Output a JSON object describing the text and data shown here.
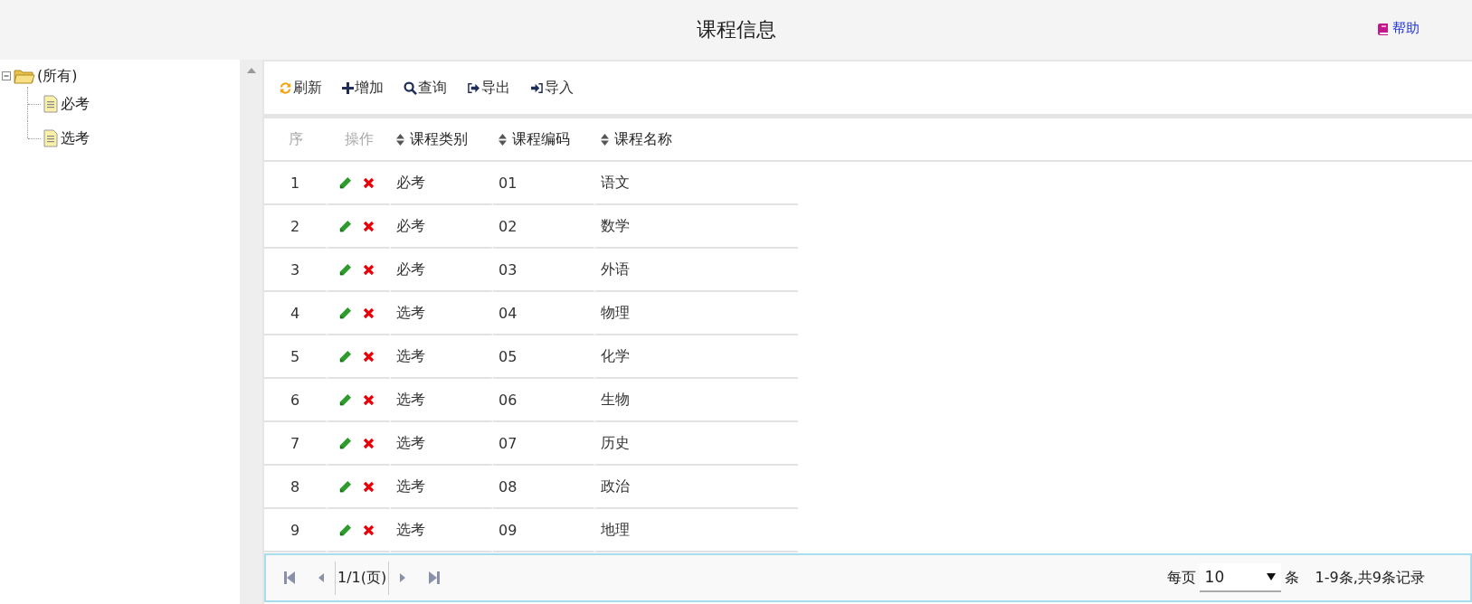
{
  "header": {
    "title": "课程信息",
    "help": "帮助"
  },
  "tree": {
    "label": "(所有)",
    "expanded": true,
    "children": [
      {
        "label": "必考"
      },
      {
        "label": "选考"
      }
    ]
  },
  "toolbar": [
    {
      "kind": "refresh",
      "label": "刷新"
    },
    {
      "kind": "add",
      "label": "增加"
    },
    {
      "kind": "search",
      "label": "查询"
    },
    {
      "kind": "export",
      "label": "导出"
    },
    {
      "kind": "import",
      "label": "导入"
    }
  ],
  "table": {
    "columns": [
      {
        "label": "序",
        "sortable": false
      },
      {
        "label": "操作",
        "sortable": false
      },
      {
        "label": "课程类别",
        "sortable": true
      },
      {
        "label": "课程编码",
        "sortable": true
      },
      {
        "label": "课程名称",
        "sortable": true
      }
    ],
    "rows": [
      {
        "no": "1",
        "category": "必考",
        "code": "01",
        "name": "语文"
      },
      {
        "no": "2",
        "category": "必考",
        "code": "02",
        "name": "数学"
      },
      {
        "no": "3",
        "category": "必考",
        "code": "03",
        "name": "外语"
      },
      {
        "no": "4",
        "category": "选考",
        "code": "04",
        "name": "物理"
      },
      {
        "no": "5",
        "category": "选考",
        "code": "05",
        "name": "化学"
      },
      {
        "no": "6",
        "category": "选考",
        "code": "06",
        "name": "生物"
      },
      {
        "no": "7",
        "category": "选考",
        "code": "07",
        "name": "历史"
      },
      {
        "no": "8",
        "category": "选考",
        "code": "08",
        "name": "政治"
      },
      {
        "no": "9",
        "category": "选考",
        "code": "09",
        "name": "地理"
      }
    ]
  },
  "pagination": {
    "page": "1/1(页)",
    "per_page_label": "每页",
    "per_page": "10",
    "per_page_unit": "条",
    "summary": "1-9条,共9条记录"
  }
}
